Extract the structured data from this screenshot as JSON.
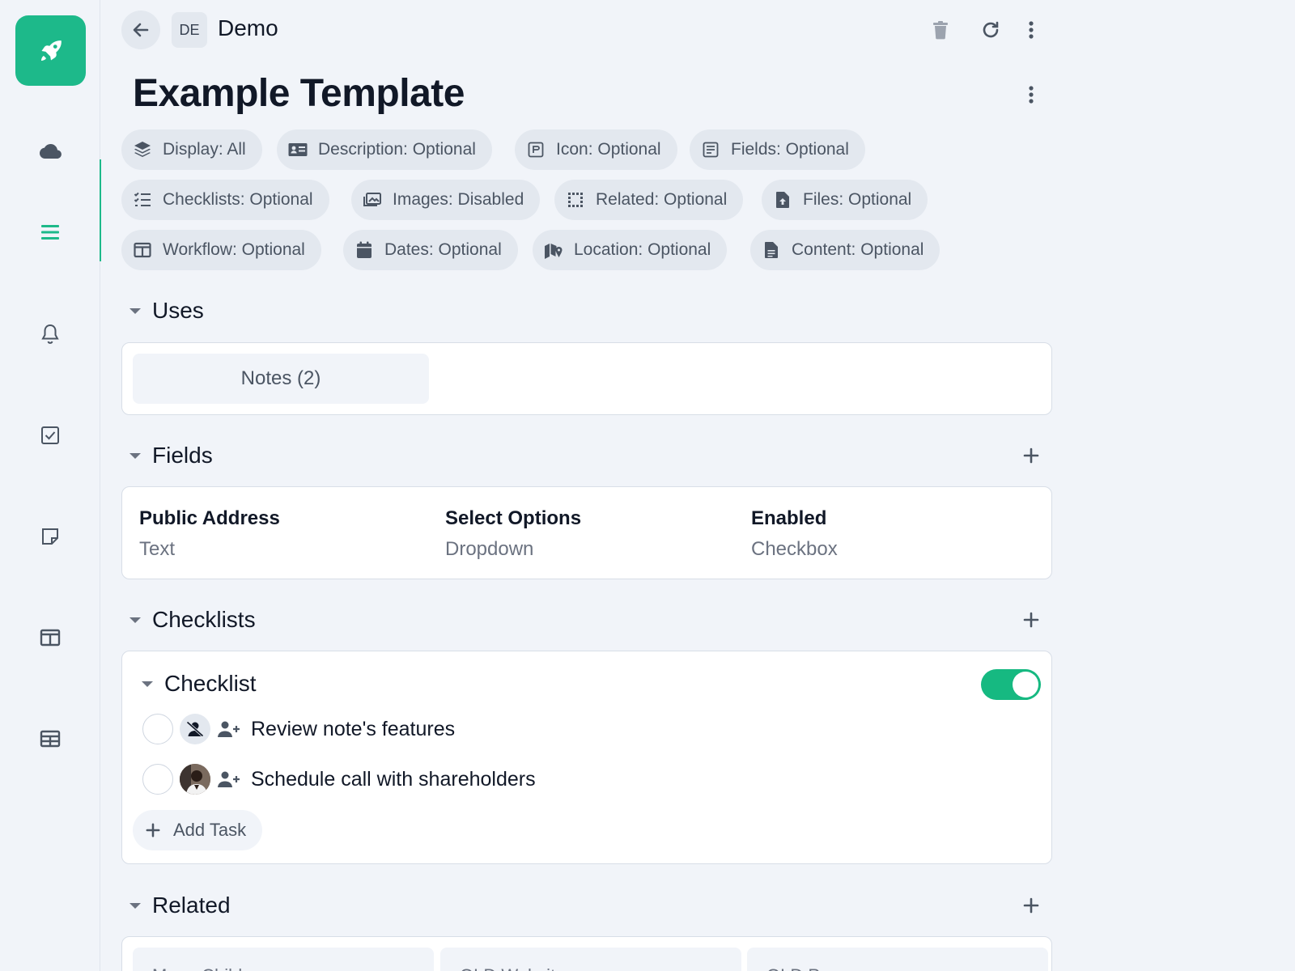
{
  "sidebar": {
    "logo_icon": "rocket-icon",
    "items": [
      {
        "name": "cloud",
        "icon": "cloud-icon"
      },
      {
        "name": "list",
        "icon": "list-icon",
        "active": true
      },
      {
        "name": "notifications",
        "icon": "bell-icon"
      },
      {
        "name": "tasks",
        "icon": "checkbox-icon"
      },
      {
        "name": "notes",
        "icon": "note-icon"
      },
      {
        "name": "board",
        "icon": "columns-icon"
      },
      {
        "name": "table",
        "icon": "table-icon"
      }
    ],
    "accent": "#1db98a"
  },
  "header": {
    "workspace_badge": "DE",
    "workspace_name": "Demo"
  },
  "page": {
    "title": "Example Template"
  },
  "pills": [
    {
      "icon": "layers-icon",
      "label": "Display: All"
    },
    {
      "icon": "id-card-icon",
      "label": "Description: Optional"
    },
    {
      "icon": "icon-frame-icon",
      "label": "Icon: Optional"
    },
    {
      "icon": "form-icon",
      "label": "Fields: Optional"
    },
    {
      "icon": "checklist-icon",
      "label": "Checklists: Optional"
    },
    {
      "icon": "images-icon",
      "label": "Images: Disabled"
    },
    {
      "icon": "grid-icon",
      "label": "Related: Optional"
    },
    {
      "icon": "file-upload-icon",
      "label": "Files: Optional"
    },
    {
      "icon": "columns-icon",
      "label": "Workflow: Optional"
    },
    {
      "icon": "calendar-icon",
      "label": "Dates: Optional"
    },
    {
      "icon": "map-icon",
      "label": "Location: Optional"
    },
    {
      "icon": "document-icon",
      "label": "Content: Optional"
    }
  ],
  "uses": {
    "heading": "Uses",
    "items": [
      "Notes (2)"
    ]
  },
  "fields": {
    "heading": "Fields",
    "items": [
      {
        "name": "Public Address",
        "type": "Text"
      },
      {
        "name": "Select Options",
        "type": "Dropdown"
      },
      {
        "name": "Enabled",
        "type": "Checkbox"
      }
    ]
  },
  "checklists": {
    "heading": "Checklists",
    "checklist_title": "Checklist",
    "enabled": true,
    "tasks": [
      {
        "label": "Review note's features",
        "assignee": "unassigned-user-icon"
      },
      {
        "label": "Schedule call with shareholders",
        "assignee": "user-photo"
      }
    ],
    "add_task_label": "Add Task"
  },
  "related": {
    "heading": "Related",
    "items": [
      "Menu Children",
      "OLD Website",
      "OLD Page"
    ]
  }
}
